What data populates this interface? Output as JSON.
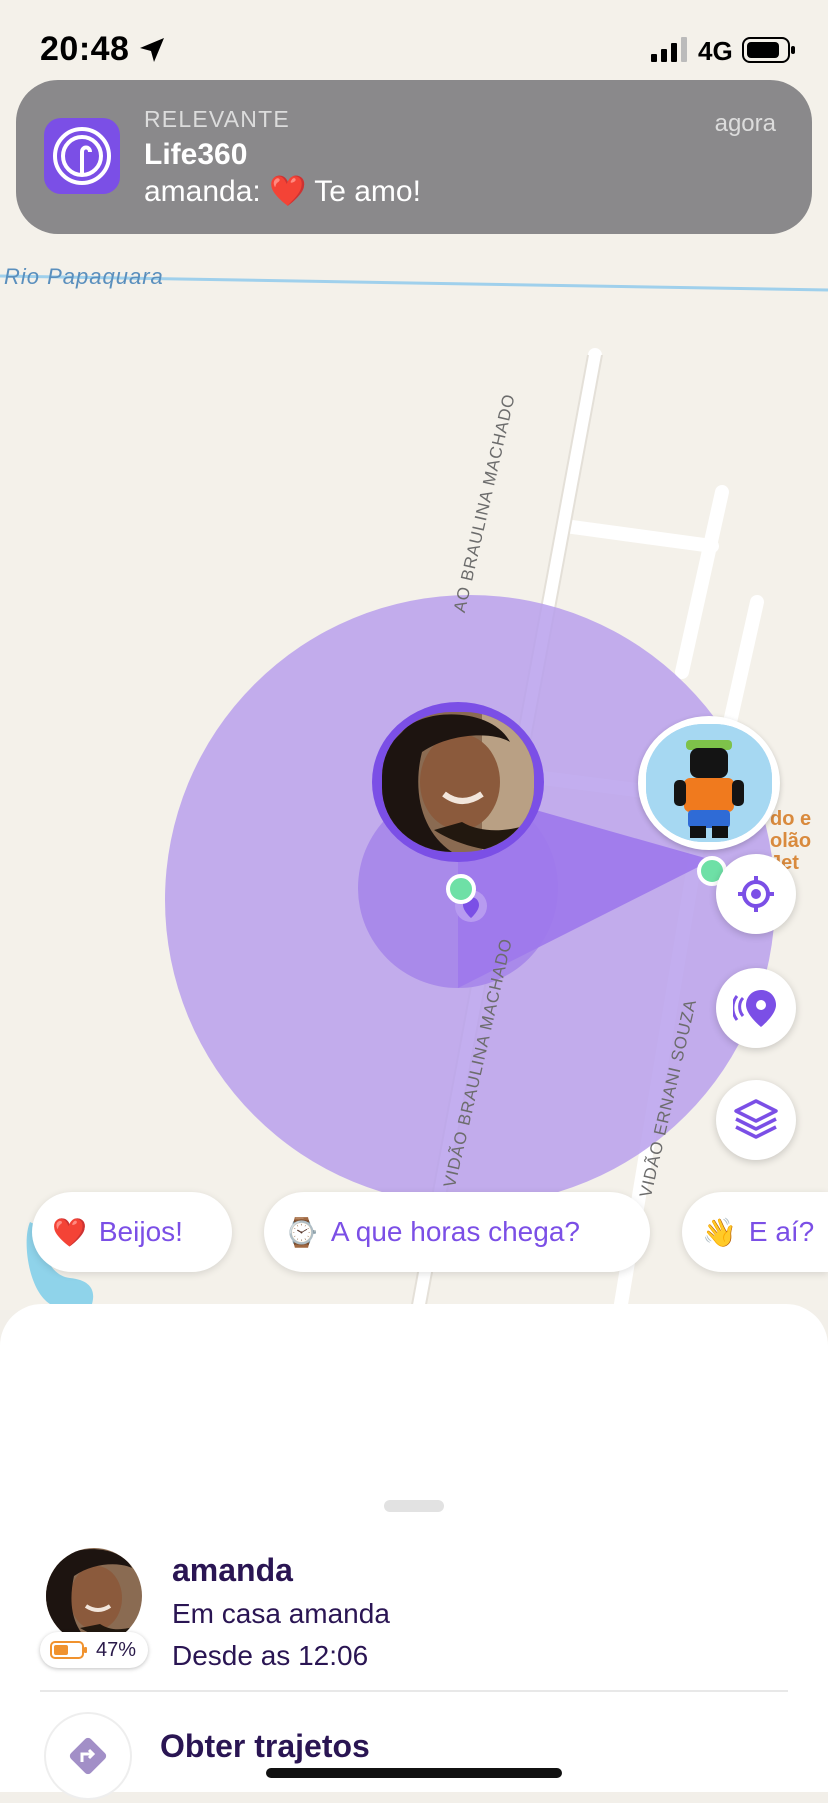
{
  "status_bar": {
    "time": "20:48",
    "network": "4G"
  },
  "notification": {
    "category": "RELEVANTE",
    "app": "Life360",
    "message": "amanda: ❤️ Te amo!",
    "time": "agora",
    "icon": "life360-app-icon"
  },
  "map": {
    "river_label": "Rio Papaquara",
    "road_labels": [
      "AO BRAULINA MACHADO",
      "VIDÃO BRAULINA MACHADO",
      "VIDÃO ERNANI SOUZA"
    ],
    "poi_label_line1": "do e",
    "poi_label_line2": "olão Jet",
    "accent_color": "#7b4fe6",
    "circle_color": "#c2a8ee"
  },
  "map_controls": [
    {
      "name": "recenter",
      "icon": "crosshair-icon"
    },
    {
      "name": "places",
      "icon": "places-pin-icon"
    },
    {
      "name": "map-layers",
      "icon": "layers-icon"
    }
  ],
  "quick_messages": [
    {
      "emoji": "❤️",
      "label": "Beijos!"
    },
    {
      "emoji": "⌚",
      "label": "A que horas chega?"
    },
    {
      "emoji": "👋",
      "label": "E aí?"
    }
  ],
  "member": {
    "name": "amanda",
    "place": "Em casa amanda",
    "since": "Desde as 12:06",
    "battery": "47%",
    "battery_color": "#f0922e"
  },
  "actions": {
    "directions": "Obter trajetos"
  }
}
